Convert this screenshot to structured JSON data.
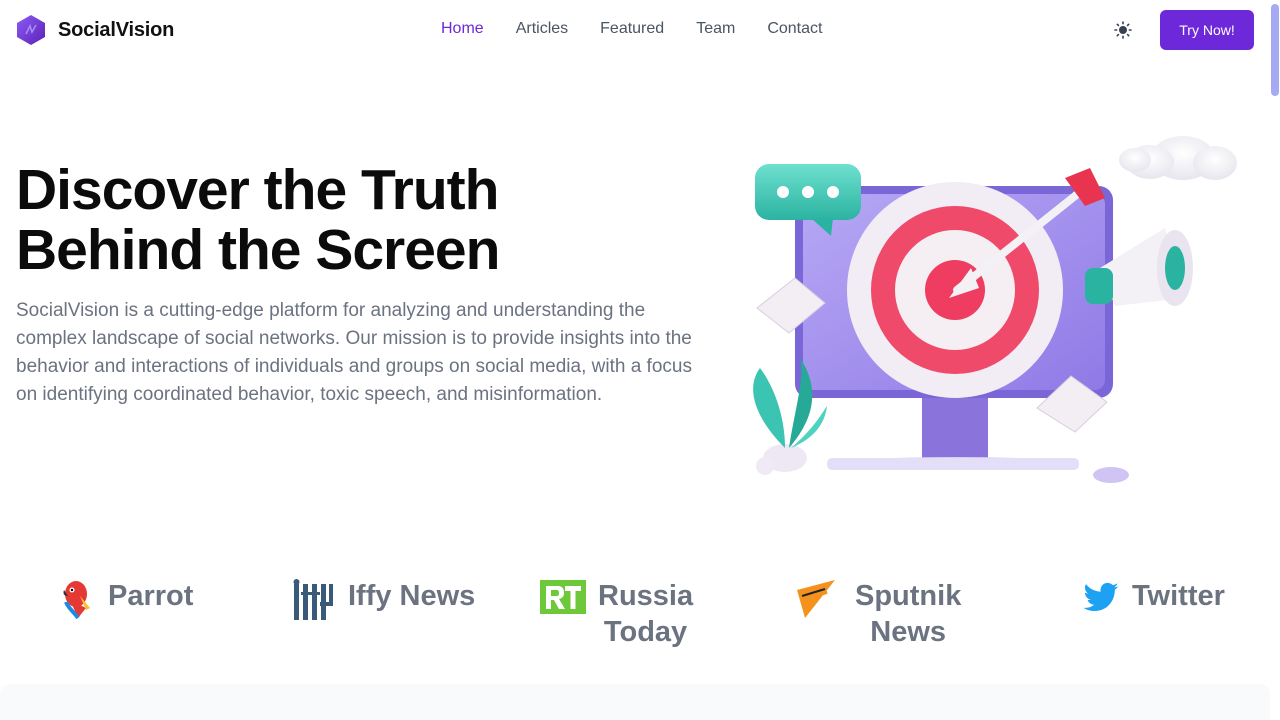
{
  "brand": {
    "name": "SocialVision"
  },
  "nav": {
    "items": [
      {
        "label": "Home",
        "active": true
      },
      {
        "label": "Articles",
        "active": false
      },
      {
        "label": "Featured",
        "active": false
      },
      {
        "label": "Team",
        "active": false
      },
      {
        "label": "Contact",
        "active": false
      }
    ],
    "theme_toggle_icon": "sun-icon",
    "cta_label": "Try Now!"
  },
  "hero": {
    "title_line1": "Discover the Truth",
    "title_line2": "Behind the Screen",
    "description": "SocialVision is a cutting-edge platform for analyzing and understanding the complex landscape of social networks. Our mission is to provide insights into the behavior and interactions of individuals and groups on social media, with a focus on identifying coordinated behavior, toxic speech, and misinformation."
  },
  "partners": [
    {
      "name": "Parrot",
      "icon": "parrot-icon"
    },
    {
      "name": "Iffy News",
      "icon": "iffy-logo-icon"
    },
    {
      "name_line1": "Russia",
      "name_line2": "Today",
      "icon": "rt-logo-icon"
    },
    {
      "name_line1": "Sputnik",
      "name_line2": "News",
      "icon": "sputnik-logo-icon"
    },
    {
      "name": "Twitter",
      "icon": "twitter-bird-icon"
    }
  ],
  "colors": {
    "accent": "#6d28d9",
    "text_muted": "#6b7280",
    "heading": "#0b0b0b",
    "band": "#f9fafb"
  }
}
